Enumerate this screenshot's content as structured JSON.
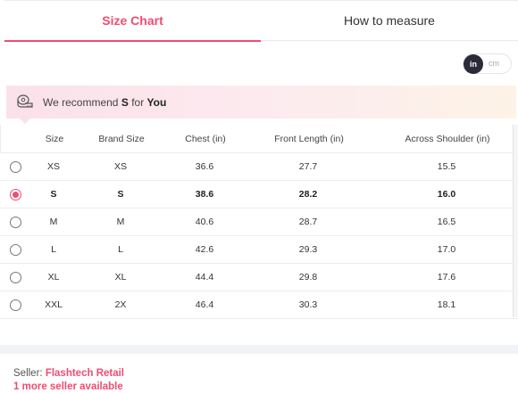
{
  "tabs": [
    {
      "label": "Size Chart",
      "active": true
    },
    {
      "label": "How to measure",
      "active": false
    }
  ],
  "unit_toggle": {
    "selected": "in",
    "options": [
      "in",
      "cm"
    ]
  },
  "recommendation": {
    "prefix": "We recommend",
    "size": "S",
    "middle": "for",
    "suffix": "You"
  },
  "table": {
    "headers": [
      "Size",
      "Brand Size",
      "Chest (in)",
      "Front Length (in)",
      "Across Shoulder (in)"
    ],
    "rows": [
      {
        "size": "XS",
        "brand": "XS",
        "chest": "36.6",
        "front": "27.7",
        "across": "15.5",
        "selected": false
      },
      {
        "size": "S",
        "brand": "S",
        "chest": "38.6",
        "front": "28.2",
        "across": "16.0",
        "selected": true
      },
      {
        "size": "M",
        "brand": "M",
        "chest": "40.6",
        "front": "28.7",
        "across": "16.5",
        "selected": false
      },
      {
        "size": "L",
        "brand": "L",
        "chest": "42.6",
        "front": "29.3",
        "across": "17.0",
        "selected": false
      },
      {
        "size": "XL",
        "brand": "XL",
        "chest": "44.4",
        "front": "29.8",
        "across": "17.6",
        "selected": false
      },
      {
        "size": "XXL",
        "brand": "2X",
        "chest": "46.4",
        "front": "30.3",
        "across": "18.1",
        "selected": false
      }
    ]
  },
  "seller": {
    "label": "Seller:",
    "name": "Flashtech Retail",
    "more": "1 more seller available"
  },
  "colors": {
    "accent": "#f14c71",
    "toggle_active": "#2a2a3a"
  }
}
